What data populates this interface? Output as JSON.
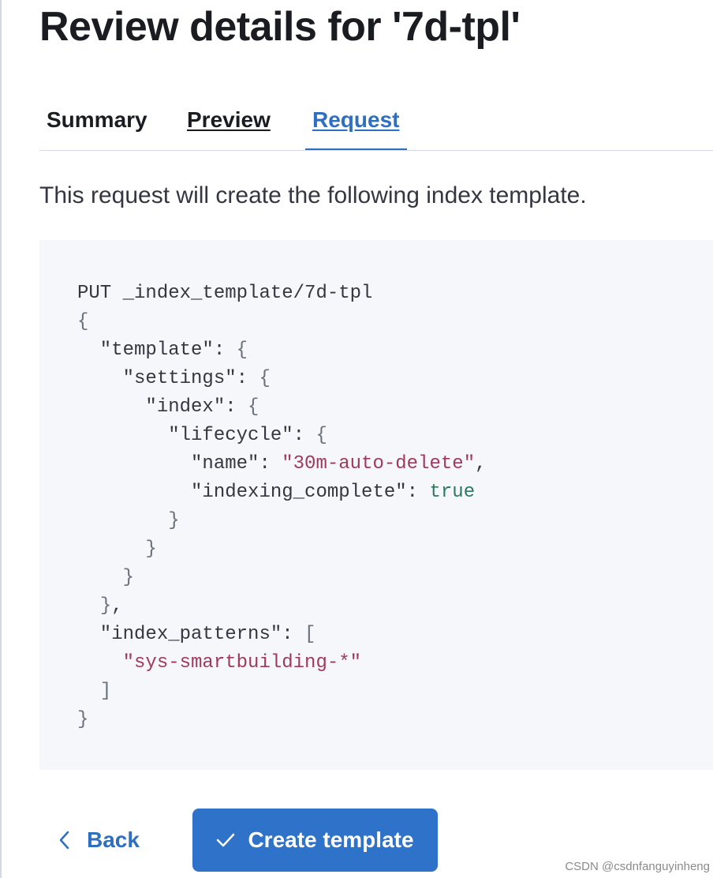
{
  "page": {
    "title": "Review details for '7d-tpl'",
    "description": "This request will create the following index template."
  },
  "tabs": [
    {
      "label": "Summary",
      "selected": false
    },
    {
      "label": "Preview",
      "selected": false
    },
    {
      "label": "Request",
      "selected": true
    }
  ],
  "request": {
    "code": "PUT _index_template/7d-tpl\n{\n  \"template\": {\n    \"settings\": {\n      \"index\": {\n        \"lifecycle\": {\n          \"name\": \"30m-auto-delete\",\n          \"indexing_complete\": true\n        }\n      }\n    }\n  },\n  \"index_patterns\": [\n    \"sys-smartbuilding-*\"\n  ]\n}"
  },
  "actions": {
    "back_label": "Back",
    "back_icon": "chevron-left-icon",
    "create_label": "Create template",
    "create_icon": "check-icon"
  },
  "watermark": "CSDN @csdnfanguyinheng",
  "colors": {
    "accent": "#2f6fc2",
    "primary_button": "#2f72c9",
    "code_background": "#f5f7fa",
    "string_token": "#a03a5c",
    "boolean_token": "#2f7a5e"
  }
}
